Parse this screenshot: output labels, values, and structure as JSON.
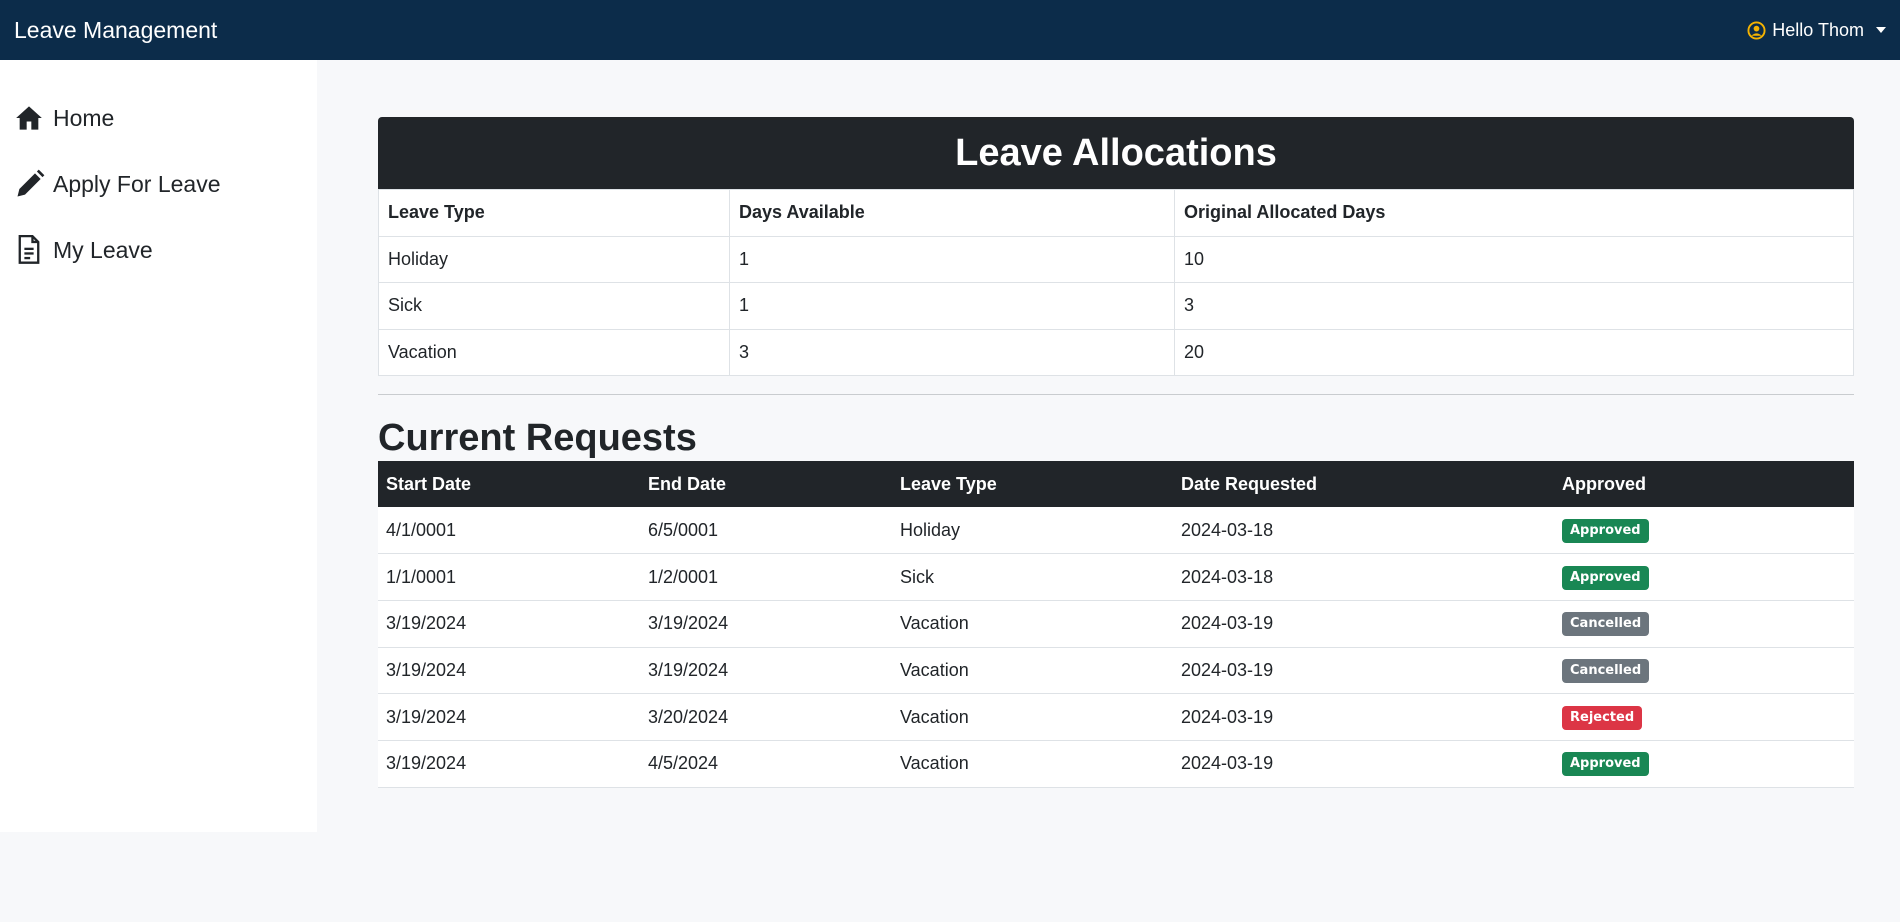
{
  "navbar": {
    "brand": "Leave Management",
    "greeting": "Hello Thom"
  },
  "sidebar": {
    "items": [
      {
        "label": "Home",
        "icon": "home-icon"
      },
      {
        "label": "Apply For Leave",
        "icon": "pencil-icon"
      },
      {
        "label": "My Leave",
        "icon": "document-icon"
      }
    ]
  },
  "allocations": {
    "title": "Leave Allocations",
    "headers": [
      "Leave Type",
      "Days Available",
      "Original Allocated Days"
    ],
    "rows": [
      [
        "Holiday",
        "1",
        "10"
      ],
      [
        "Sick",
        "1",
        "3"
      ],
      [
        "Vacation",
        "3",
        "20"
      ]
    ]
  },
  "requests": {
    "title": "Current Requests",
    "headers": [
      "Start Date",
      "End Date",
      "Leave Type",
      "Date Requested",
      "Approved"
    ],
    "rows": [
      {
        "start": "4/1/0001",
        "end": "6/5/0001",
        "type": "Holiday",
        "requested": "2024-03-18",
        "status": "Approved",
        "status_color": "#198754"
      },
      {
        "start": "1/1/0001",
        "end": "1/2/0001",
        "type": "Sick",
        "requested": "2024-03-18",
        "status": "Approved",
        "status_color": "#198754"
      },
      {
        "start": "3/19/2024",
        "end": "3/19/2024",
        "type": "Vacation",
        "requested": "2024-03-19",
        "status": "Cancelled",
        "status_color": "#6c757d"
      },
      {
        "start": "3/19/2024",
        "end": "3/19/2024",
        "type": "Vacation",
        "requested": "2024-03-19",
        "status": "Cancelled",
        "status_color": "#6c757d"
      },
      {
        "start": "3/19/2024",
        "end": "3/20/2024",
        "type": "Vacation",
        "requested": "2024-03-19",
        "status": "Rejected",
        "status_color": "#dc3545"
      },
      {
        "start": "3/19/2024",
        "end": "4/5/2024",
        "type": "Vacation",
        "requested": "2024-03-19",
        "status": "Approved",
        "status_color": "#198754"
      }
    ]
  },
  "colors": {
    "navbar": "#0c2c4a",
    "dark": "#212529",
    "user_icon": "#f5b301"
  }
}
